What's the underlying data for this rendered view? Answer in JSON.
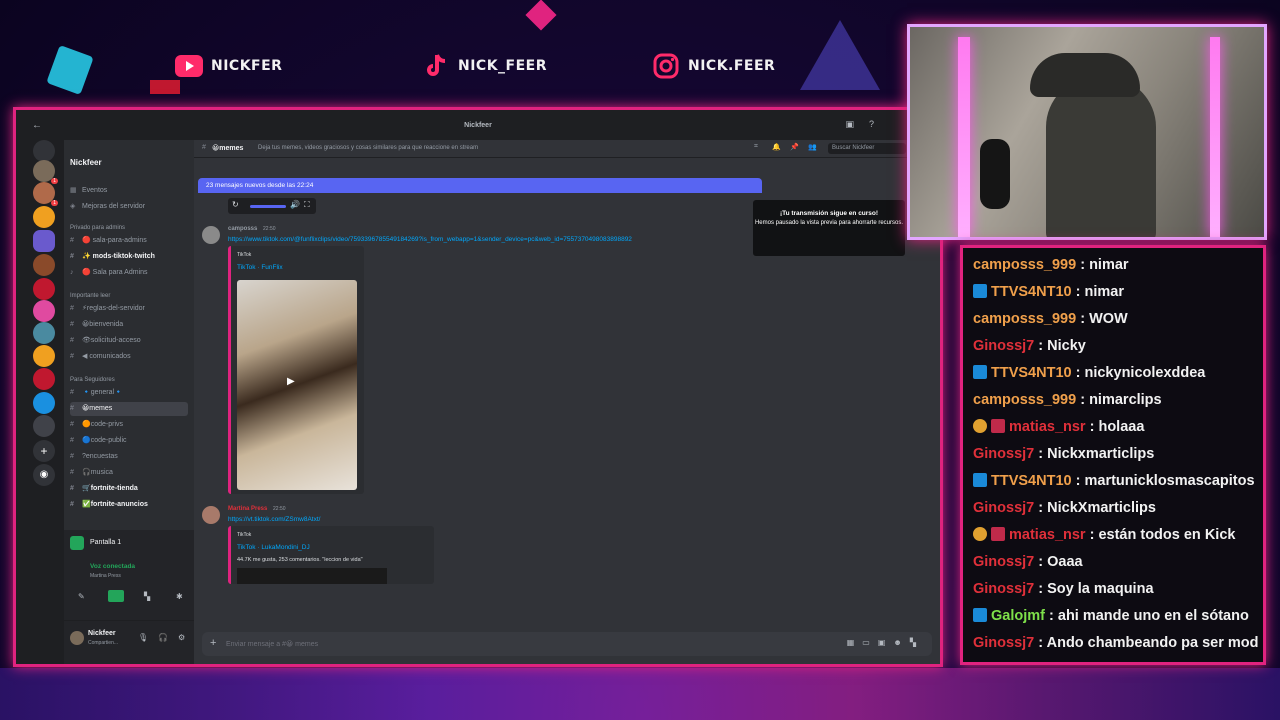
{
  "social": [
    {
      "platform": "youtube-icon",
      "handle": "NICKFER"
    },
    {
      "platform": "tiktok-icon",
      "handle": "NICK_FEER"
    },
    {
      "platform": "instagram-icon",
      "handle": "NICK.FEER"
    }
  ],
  "discord": {
    "window_title": "Nickfeer",
    "server_name": "Nickfeer",
    "top_items": [
      "Eventos",
      "Mejoras del servidor"
    ],
    "categories": [
      "Privado para admins",
      "Importante leer",
      "Para Seguidores"
    ],
    "channels": [
      {
        "label": "🔴 sala-para-admins",
        "style": "normal"
      },
      {
        "label": "✨ mods-tiktok-twitch",
        "style": "bright"
      },
      {
        "label": "🔴 Sala para Admins",
        "style": "normal"
      },
      {
        "label": "⚡reglas-del-servidor",
        "style": "normal"
      },
      {
        "label": "😀bienvenida",
        "style": "normal"
      },
      {
        "label": "👁solicitud-acceso",
        "style": "normal"
      },
      {
        "label": "◀ comunicados",
        "style": "normal"
      },
      {
        "label": "🔹general🔹",
        "style": "normal"
      },
      {
        "label": "😀memes",
        "style": "active"
      },
      {
        "label": "🟠code-privs",
        "style": "normal"
      },
      {
        "label": "🔵code-public",
        "style": "normal"
      },
      {
        "label": "?encuestas",
        "style": "normal"
      },
      {
        "label": "🎧musica",
        "style": "normal"
      },
      {
        "label": "🛒fortnite-tienda",
        "style": "bright"
      },
      {
        "label": "✅fortnite-anuncios",
        "style": "bright"
      }
    ],
    "voice": {
      "stream_label": "Pantalla 1",
      "status": "Voz conectada",
      "sub": "Martina Press"
    },
    "user": {
      "name": "Nickfeer",
      "status": "Compartien..."
    },
    "channel_header": {
      "name": "😀memes",
      "topic": "Deja tus memes, videos graciosos y cosas similares para que reaccione en stream",
      "search_placeholder": "Buscar Nickfeer"
    },
    "new_messages": "23 mensajes nuevos desde las 22:24",
    "toast": {
      "title": "¡Tu transmisión sigue en curso!",
      "body": "Hemos pausado la vista previa para ahorrarte recursos."
    },
    "messages": [
      {
        "author": "camposss",
        "time": "22:50",
        "link": "https://www.tiktok.com/@funflixclips/video/7593396785549184269?is_from_webapp=1&sender_device=pc&web_id=7557370498083898892",
        "embed_provider": "TikTok",
        "embed_title": "TikTok · FunFlix"
      },
      {
        "author": "Martina Press",
        "time": "22:50",
        "link": "https://vt.tiktok.com/ZSmw8Atxt/",
        "embed_provider": "TikTok",
        "embed_title": "TikTok · LukaMondini_DJ",
        "embed_desc": "44.7K me gusta, 253 comentarios. \"leccion de vida\""
      }
    ],
    "composer_placeholder": "Enviar mensaje a #😀 memes"
  },
  "chat": [
    {
      "user": "camposss_999",
      "color": "#f0a04b",
      "badge": "",
      "text": "nimar"
    },
    {
      "user": "TTVS4NT10",
      "color": "#f0a04b",
      "badge": "blue",
      "text": "nimar"
    },
    {
      "user": "camposss_999",
      "color": "#f0a04b",
      "badge": "",
      "text": "WOW"
    },
    {
      "user": "Ginossj7",
      "color": "#e0303a",
      "badge": "",
      "text": "Nicky"
    },
    {
      "user": "TTVS4NT10",
      "color": "#f0a04b",
      "badge": "blue",
      "text": "nickynicolexddea"
    },
    {
      "user": "camposss_999",
      "color": "#f0a04b",
      "badge": "",
      "text": "nimarclips"
    },
    {
      "user": "matias_nsr",
      "color": "#e0303a",
      "badge": "gold-sword",
      "text": "holaaa"
    },
    {
      "user": "Ginossj7",
      "color": "#e0303a",
      "badge": "",
      "text": "Nickxmarticlips"
    },
    {
      "user": "TTVS4NT10",
      "color": "#f0a04b",
      "badge": "blue",
      "text": "martunicklosmascapitos"
    },
    {
      "user": "Ginossj7",
      "color": "#e0303a",
      "badge": "",
      "text": "NickXmarticlips"
    },
    {
      "user": "matias_nsr",
      "color": "#e0303a",
      "badge": "gold-sword",
      "text": "están todos en Kick"
    },
    {
      "user": "Ginossj7",
      "color": "#e0303a",
      "badge": "",
      "text": "Oaaa"
    },
    {
      "user": "Ginossj7",
      "color": "#e0303a",
      "badge": "",
      "text": "Soy la maquina"
    },
    {
      "user": "Galojmf",
      "color": "#7ee04a",
      "badge": "blue",
      "text": "ahi mande uno en el sótano"
    },
    {
      "user": "Ginossj7",
      "color": "#e0303a",
      "badge": "",
      "text": "Ando chambeando pa ser mod"
    }
  ]
}
